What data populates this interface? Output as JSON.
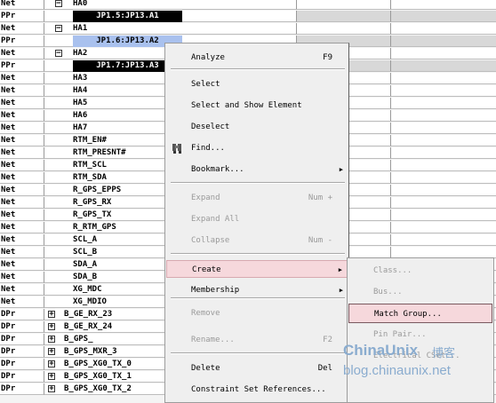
{
  "rows": [
    {
      "type": "Net",
      "name": "HA0",
      "expander": "minus"
    },
    {
      "type": "PPr",
      "pin": "JP1.5:JP13.A1",
      "selected": false
    },
    {
      "type": "Net",
      "name": "HA1",
      "expander": "minus"
    },
    {
      "type": "PPr",
      "pin": "JP1.6:JP13.A2",
      "selected": true
    },
    {
      "type": "Net",
      "name": "HA2",
      "expander": "minus"
    },
    {
      "type": "PPr",
      "pin": "JP1.7:JP13.A3",
      "selected": false
    },
    {
      "type": "Net",
      "name": "HA3"
    },
    {
      "type": "Net",
      "name": "HA4"
    },
    {
      "type": "Net",
      "name": "HA5"
    },
    {
      "type": "Net",
      "name": "HA6"
    },
    {
      "type": "Net",
      "name": "HA7"
    },
    {
      "type": "Net",
      "name": "RTM_EN#"
    },
    {
      "type": "Net",
      "name": "RTM_PRESNT#"
    },
    {
      "type": "Net",
      "name": "RTM_SCL"
    },
    {
      "type": "Net",
      "name": "RTM_SDA"
    },
    {
      "type": "Net",
      "name": "R_GPS_EPPS"
    },
    {
      "type": "Net",
      "name": "R_GPS_RX"
    },
    {
      "type": "Net",
      "name": "R_GPS_TX"
    },
    {
      "type": "Net",
      "name": "R_RTM_GPS"
    },
    {
      "type": "Net",
      "name": "SCL_A"
    },
    {
      "type": "Net",
      "name": "SCL_B"
    },
    {
      "type": "Net",
      "name": "SDA_A"
    },
    {
      "type": "Net",
      "name": "SDA_B"
    },
    {
      "type": "Net",
      "name": "XG_MDC"
    },
    {
      "type": "Net",
      "name": "XG_MDIO"
    },
    {
      "type": "DPr",
      "name": "B_GE_RX_23",
      "expander": "plus"
    },
    {
      "type": "DPr",
      "name": "B_GE_RX_24",
      "expander": "plus"
    },
    {
      "type": "DPr",
      "name": "B_GPS_",
      "expander": "plus"
    },
    {
      "type": "DPr",
      "name": "B_GPS_MXR_3",
      "expander": "plus"
    },
    {
      "type": "DPr",
      "name": "B_GPS_XG0_TX_0",
      "expander": "plus"
    },
    {
      "type": "DPr",
      "name": "B_GPS_XG0_TX_1",
      "expander": "plus"
    },
    {
      "type": "DPr",
      "name": "B_GPS_XG0_TX_2",
      "expander": "plus"
    }
  ],
  "context_menu": {
    "items": [
      {
        "label": "Analyze",
        "shortcut": "F9",
        "disabled": false
      },
      {
        "separator": true
      },
      {
        "label": "Select",
        "disabled": false
      },
      {
        "label": "Select and Show Element",
        "disabled": false
      },
      {
        "label": "Deselect",
        "disabled": false
      },
      {
        "label": "Find...",
        "disabled": false,
        "icon": "find-icon"
      },
      {
        "label": "Bookmark...",
        "disabled": false,
        "submenu": true
      },
      {
        "separator": true
      },
      {
        "label": "Expand",
        "shortcut": "Num +",
        "disabled": true
      },
      {
        "label": "Expand All",
        "disabled": true
      },
      {
        "label": "Collapse",
        "shortcut": "Num -",
        "disabled": true
      },
      {
        "separator": true
      },
      {
        "label": "Create",
        "disabled": false,
        "submenu": true,
        "highlighted": true
      },
      {
        "label": "Membership",
        "disabled": false,
        "submenu": true
      },
      {
        "label": "Remove",
        "disabled": true
      },
      {
        "separator": true
      },
      {
        "label": "Rename...",
        "shortcut": "F2",
        "disabled": true
      },
      {
        "label": "Delete",
        "shortcut": "Del",
        "disabled": false
      },
      {
        "separator": true
      },
      {
        "label": "Constraint Set References...",
        "disabled": false
      }
    ]
  },
  "create_submenu": {
    "items": [
      {
        "label": "Class...",
        "disabled": true
      },
      {
        "label": "Bus...",
        "disabled": true
      },
      {
        "label": "Match Group...",
        "disabled": false,
        "highlighted": true
      },
      {
        "label": "Pin Pair...",
        "disabled": true
      },
      {
        "label": "Electrical CSet...",
        "disabled": true
      }
    ]
  },
  "watermark": {
    "brand": "ChinaUnix",
    "blog": "博客",
    "url": "blog.chinaunix.net"
  },
  "colors": {
    "selection": "#a9c1ee",
    "menu_highlight": "#f6d8dc",
    "pin_bg": "#000000",
    "watermark": "#8aaccf"
  }
}
